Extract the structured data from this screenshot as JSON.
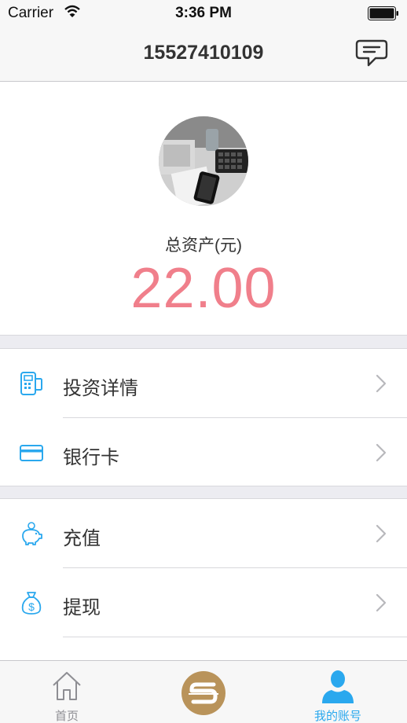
{
  "status_bar": {
    "carrier": "Carrier",
    "time": "3:36 PM"
  },
  "nav": {
    "title": "15527410109",
    "message_icon": "chat-bubble-icon"
  },
  "profile": {
    "assets_label": "总资产(元)",
    "assets_value": "22.00"
  },
  "menu_groups": [
    [
      {
        "label": "投资详情",
        "icon": "pos-terminal-icon"
      },
      {
        "label": "银行卡",
        "icon": "credit-card-icon"
      }
    ],
    [
      {
        "label": "充值",
        "icon": "piggy-bank-icon"
      },
      {
        "label": "提现",
        "icon": "money-bag-icon"
      }
    ]
  ],
  "tabs": [
    {
      "label": "首页",
      "icon": "home-icon"
    },
    {
      "label": "",
      "icon": "brand-logo-icon"
    },
    {
      "label": "我的账号",
      "icon": "user-icon"
    }
  ],
  "colors": {
    "accent": "#2aa8ee",
    "assets_value": "#f07f8b",
    "brand_gold": "#b9935a",
    "background": "#ececf1"
  }
}
